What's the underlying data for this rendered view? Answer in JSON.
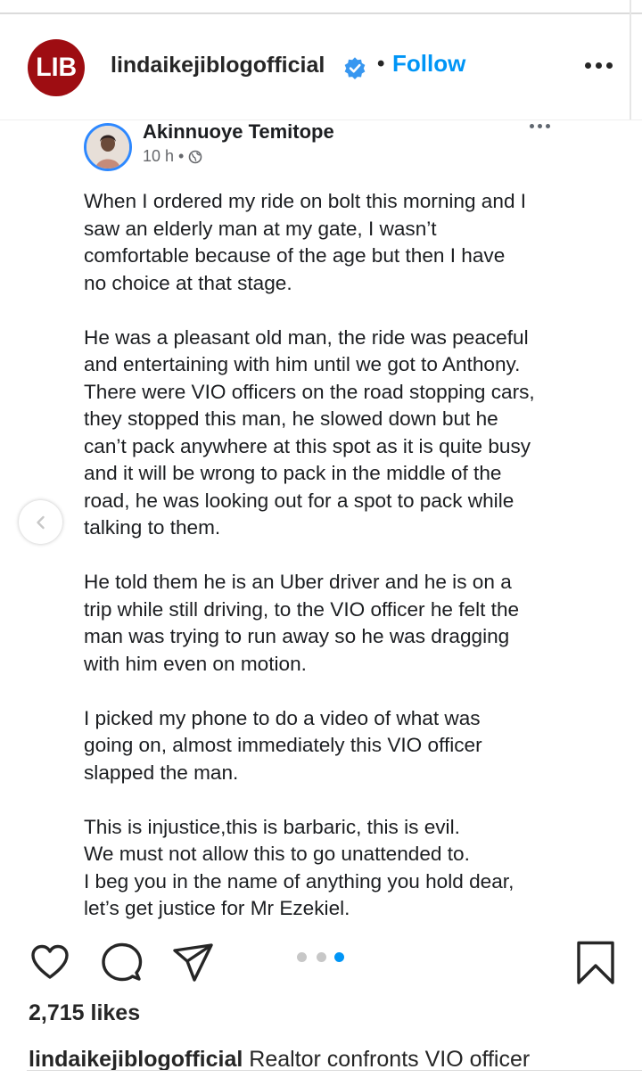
{
  "header": {
    "username": "lindaikejiblogofficial",
    "separator": "•",
    "follow_label": "Follow",
    "avatar_text": "LIB",
    "brand_color": "#9e0d12",
    "accent_color": "#0095f6"
  },
  "post_image": {
    "author": "Akinnuoye Temitope",
    "time": "10 h",
    "time_separator": "•",
    "paragraphs": [
      "When I ordered my ride on bolt this morning and I\nsaw an elderly man at my gate, I wasn’t\ncomfortable because of the age but then I have\nno choice at that stage.",
      "He was a pleasant old man, the ride was peaceful\nand entertaining with him until we got to Anthony.\nThere were VIO officers on the road stopping cars,\nthey stopped this man, he slowed down but he\ncan’t pack anywhere at this spot as it is quite busy\nand it will be wrong to pack in the middle of the\nroad, he was looking out for a spot to pack while\ntalking to them.",
      "He told them he is an Uber driver and he is on a\ntrip while still driving, to the VIO officer he felt the\nman was trying to run away so he was dragging\nwith him even on motion.",
      "I picked my phone to do a video of what was\ngoing on, almost immediately this VIO officer\nslapped the man.",
      "This is injustice,this is barbaric, this is evil.\nWe must not allow this to go unattended to.\nI beg you in the name of anything you hold dear,\nlet’s get justice for Mr Ezekiel."
    ]
  },
  "carousel": {
    "total": 3,
    "active_index": 2
  },
  "icons": {
    "like": "heart-icon",
    "comment": "comment-icon",
    "share": "paper-plane-icon",
    "save": "bookmark-icon",
    "verified": "verified-badge-icon",
    "globe": "globe-icon",
    "prev": "chevron-left-icon"
  },
  "likes_text": "2,715 likes",
  "caption": {
    "username": "lindaikejiblogofficial",
    "text": "Realtor confronts VIO officer"
  }
}
